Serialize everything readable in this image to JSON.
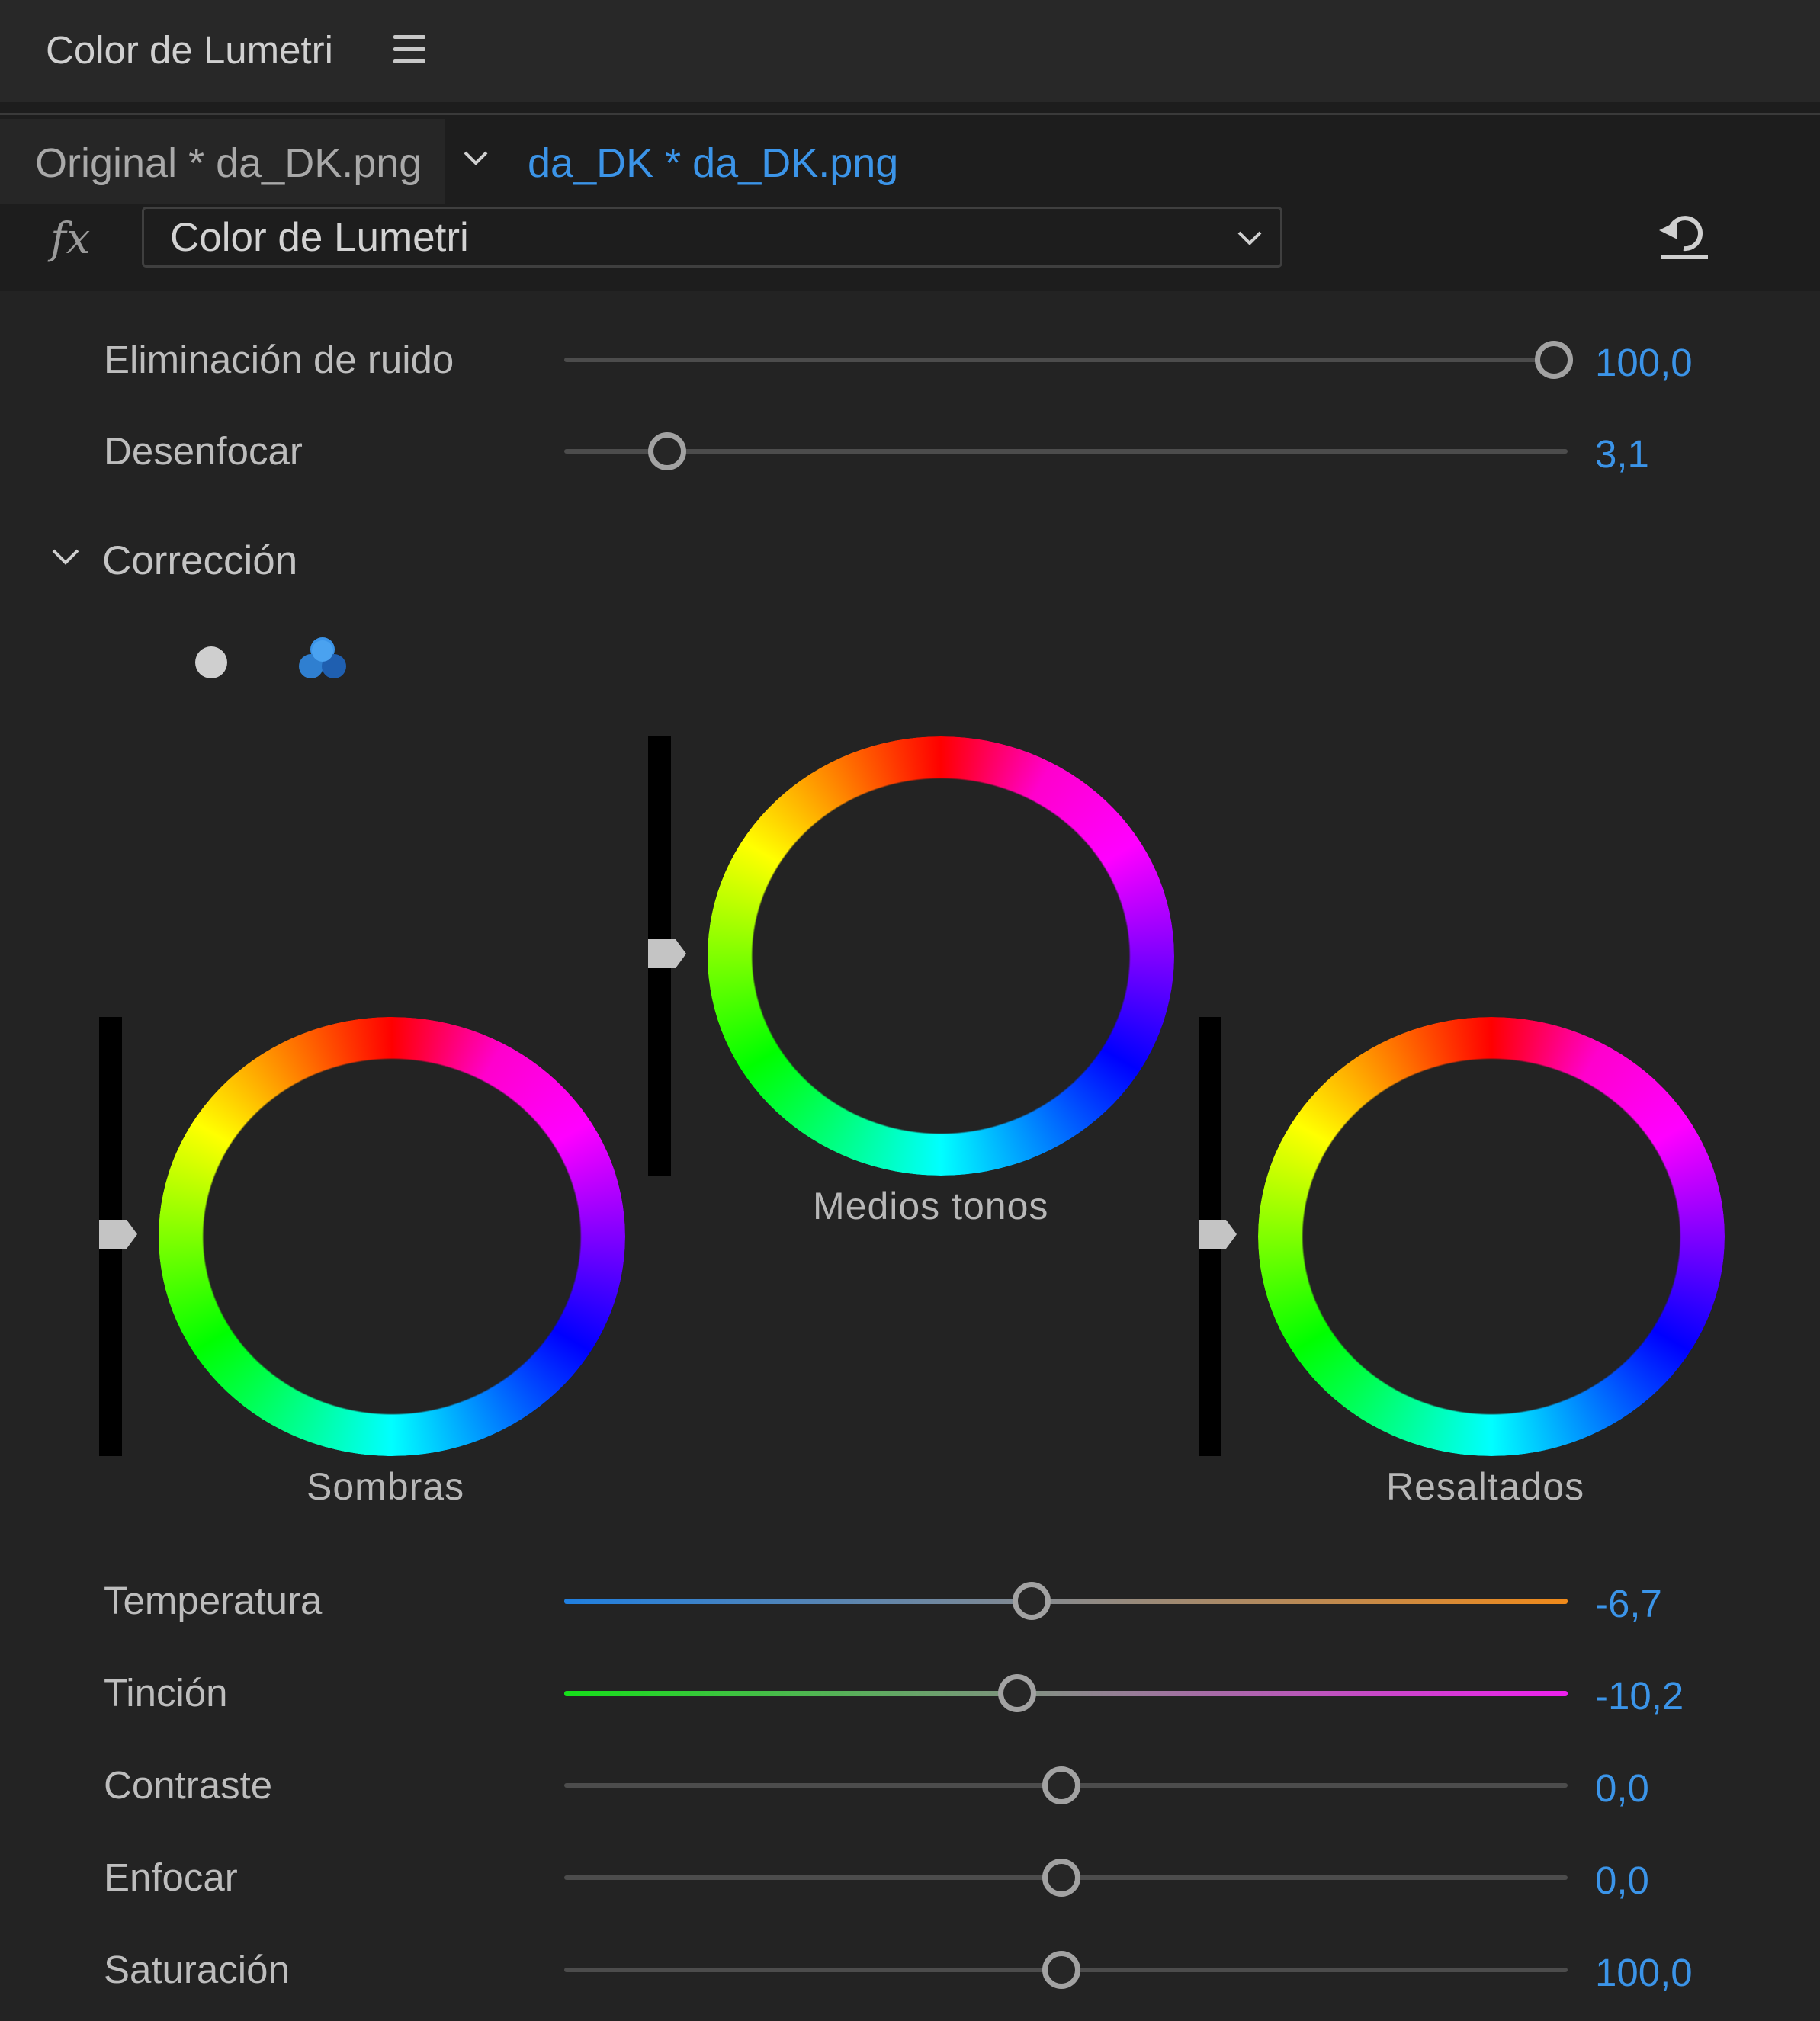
{
  "panel": {
    "title": "Color de Lumetri",
    "menu_icon": "hamburger-menu-icon"
  },
  "source": {
    "original_tab": "Original * da_DK.png",
    "active_tab": "da_DK * da_DK.png",
    "chevron_icon": "chevron-down-icon"
  },
  "effect": {
    "fx_label": "fx",
    "selected": "Color de Lumetri",
    "reset_icon": "reset-icon"
  },
  "sliders_top": [
    {
      "label": "Eliminación de ruido",
      "value": "100,0",
      "position": 1.0
    },
    {
      "label": "Desenfocar",
      "value": "3,1",
      "position": 0.1
    }
  ],
  "section": {
    "title": "Corrección",
    "expanded": true,
    "mode_icons": [
      "single-wheel-icon",
      "three-wheels-icon"
    ],
    "active_mode": "three-wheels-icon"
  },
  "wheels": {
    "shadows": {
      "label": "Sombras",
      "level": 0.5
    },
    "midtones": {
      "label": "Medios tonos",
      "level": 0.5
    },
    "highlights": {
      "label": "Resaltados",
      "level": 0.5
    }
  },
  "sliders_bottom": [
    {
      "label": "Temperatura",
      "value": "-6,7",
      "position": 0.47,
      "gradient": [
        "#1f7fe0",
        "#f08a1a"
      ]
    },
    {
      "label": "Tinción",
      "value": "-10,2",
      "position": 0.455,
      "gradient": [
        "#16e01a",
        "#ee20ee"
      ]
    },
    {
      "label": "Contraste",
      "value": "0,0",
      "position": 0.5
    },
    {
      "label": "Enfocar",
      "value": "0,0",
      "position": 0.5
    },
    {
      "label": "Saturación",
      "value": "100,0",
      "position": 0.5
    }
  ],
  "colors": {
    "accent": "#3b94e8",
    "panel_bg": "#232323"
  }
}
